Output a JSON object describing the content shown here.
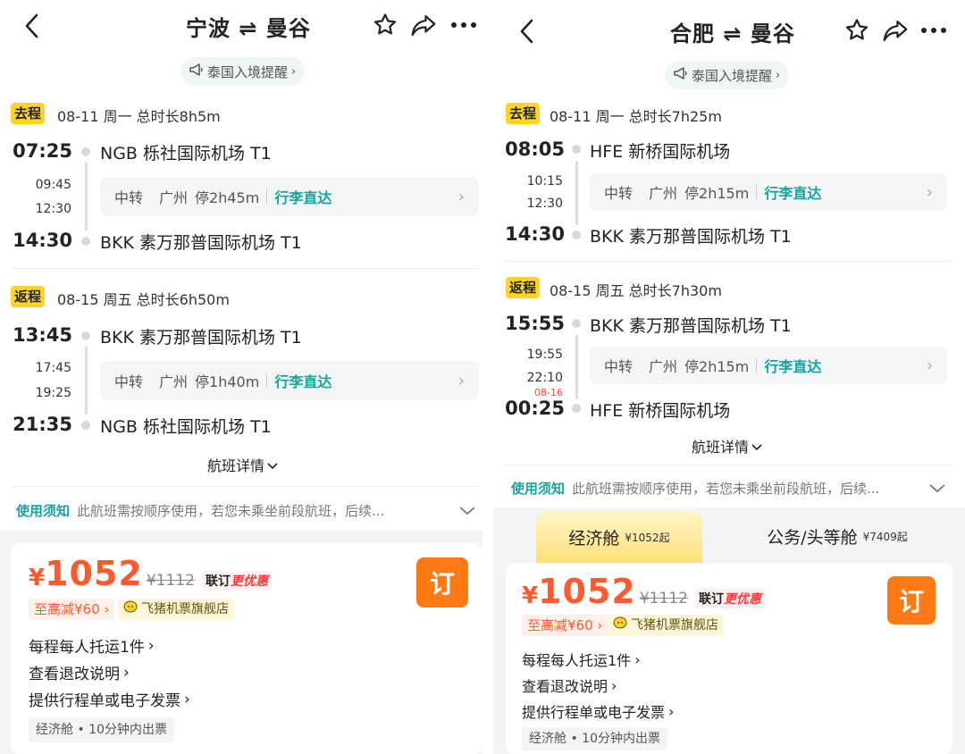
{
  "panels": [
    {
      "header": {
        "title": "宁波 ⇌ 曼谷"
      },
      "notice_chip": "泰国入境提醒",
      "outbound": {
        "tag": "去程",
        "info": "08-11  周一  总时长8h5m",
        "dep_time": "07:25",
        "dep_airport": "NGB 栎社国际机场 T1",
        "stop_arr": "09:45",
        "stop_dep": "12:30",
        "next_day": "",
        "transit": {
          "label": "中转",
          "city": "广州",
          "stay": "停2h45m",
          "luggage": "行李直达"
        },
        "arr_time": "14:30",
        "arr_airport": "BKK 素万那普国际机场 T1"
      },
      "return": {
        "tag": "返程",
        "info": "08-15  周五  总时长6h50m",
        "dep_time": "13:45",
        "dep_airport": "BKK 素万那普国际机场 T1",
        "stop_arr": "17:45",
        "stop_dep": "19:25",
        "next_day": "",
        "transit": {
          "label": "中转",
          "city": "广州",
          "stay": "停1h40m",
          "luggage": "行李直达"
        },
        "arr_time": "21:35",
        "arr_airport": "NGB 栎社国际机场 T1"
      },
      "details_link": "航班详情",
      "usage": {
        "title": "使用须知",
        "text": "此航班需按顺序使用，若您未乘坐前段航班，后续..."
      },
      "price": {
        "currency": "¥",
        "amount": "1052",
        "original": "¥1112",
        "combo_a": "联订",
        "combo_b": "更优惠",
        "reduce": "至高减¥60",
        "store": "飞猪机票旗舰店",
        "book": "订"
      },
      "info_lines": [
        "每程每人托运1件",
        "查看退改说明",
        "提供行程单或电子发票"
      ],
      "econ_tag": "经济舱 • 10分钟内出票"
    },
    {
      "header": {
        "title": "合肥 ⇌ 曼谷"
      },
      "notice_chip": "泰国入境提醒",
      "outbound": {
        "tag": "去程",
        "info": "08-11  周一  总时长7h25m",
        "dep_time": "08:05",
        "dep_airport": "HFE 新桥国际机场",
        "stop_arr": "10:15",
        "stop_dep": "12:30",
        "next_day": "",
        "transit": {
          "label": "中转",
          "city": "广州",
          "stay": "停2h15m",
          "luggage": "行李直达"
        },
        "arr_time": "14:30",
        "arr_airport": "BKK 素万那普国际机场 T1"
      },
      "return": {
        "tag": "返程",
        "info": "08-15  周五  总时长7h30m",
        "dep_time": "15:55",
        "dep_airport": "BKK 素万那普国际机场 T1",
        "stop_arr": "19:55",
        "stop_dep": "22:10",
        "next_day": "08-16",
        "transit": {
          "label": "中转",
          "city": "广州",
          "stay": "停2h15m",
          "luggage": "行李直达"
        },
        "arr_time": "00:25",
        "arr_airport": "HFE 新桥国际机场"
      },
      "details_link": "航班详情",
      "usage": {
        "title": "使用须知",
        "text": "此航班需按顺序使用，若您未乘坐前段航班，后续..."
      },
      "cabins": [
        {
          "name": "经济舱",
          "price": "¥1052起"
        },
        {
          "name": "公务/头等舱",
          "price": "¥7409起"
        }
      ],
      "price": {
        "currency": "¥",
        "amount": "1052",
        "original": "¥1112",
        "combo_a": "联订",
        "combo_b": "更优惠",
        "reduce": "至高减¥60",
        "store": "飞猪机票旗舰店",
        "book": "订"
      },
      "info_lines": [
        "每程每人托运1件",
        "查看退改说明",
        "提供行程单或电子发票"
      ],
      "econ_tag": "经济舱 • 10分钟内出票"
    }
  ],
  "colors": {
    "accent_orange": "#ff7a14",
    "price_red": "#ff5a2e",
    "teal": "#17a3a0",
    "tag_yellow": "#ffd426"
  }
}
